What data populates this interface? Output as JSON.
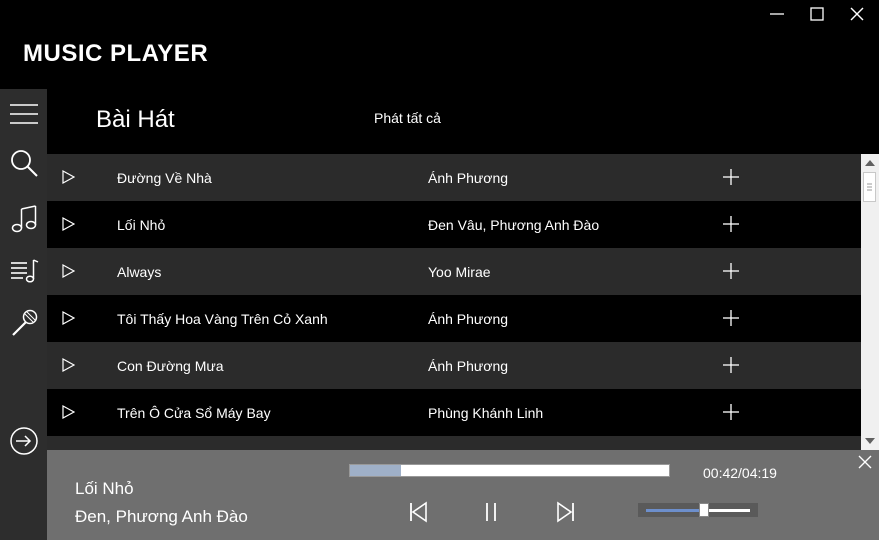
{
  "window": {
    "title": "MUSIC PLAYER",
    "controls": [
      "minimize-icon",
      "maximize-icon",
      "close-icon"
    ]
  },
  "sidebar": {
    "items": [
      {
        "name": "menu",
        "icon": "hamburger-icon"
      },
      {
        "name": "search",
        "icon": "search-icon"
      },
      {
        "name": "songs",
        "icon": "music-note-icon"
      },
      {
        "name": "playlist",
        "icon": "playlist-icon"
      },
      {
        "name": "artists",
        "icon": "microphone-icon"
      },
      {
        "name": "logout",
        "icon": "sign-out-icon"
      }
    ]
  },
  "header": {
    "title": "Bài Hát",
    "play_all": "Phát tất cả"
  },
  "songs": [
    {
      "title": "Đường Về Nhà",
      "artist": "Ánh Phương"
    },
    {
      "title": "Lối Nhỏ",
      "artist": "Đen Vâu, Phương Anh Đào"
    },
    {
      "title": "Always",
      "artist": "Yoo Mirae"
    },
    {
      "title": "Tôi Thấy Hoa Vàng Trên Cỏ Xanh",
      "artist": "Ánh Phương"
    },
    {
      "title": "Con Đường Mưa",
      "artist": "Ánh Phương"
    },
    {
      "title": "Trên Ô Cửa Sổ Máy Bay",
      "artist": "Phùng Khánh Linh"
    },
    {
      "title": "",
      "artist": ""
    }
  ],
  "player": {
    "title": "Lối Nhỏ",
    "artist": "Đen, Phương Anh Đào",
    "time": "00:42/04:19",
    "progress": 0.16,
    "volume": 0.56
  },
  "colors": {
    "background": "#000000",
    "sidebar": "#2d2d2d",
    "row_alt": "#2b2b2b",
    "player_bar": "#6f6f6f",
    "progress_fill": "#9fb0c8",
    "volume_fill": "#6d8fcc"
  }
}
